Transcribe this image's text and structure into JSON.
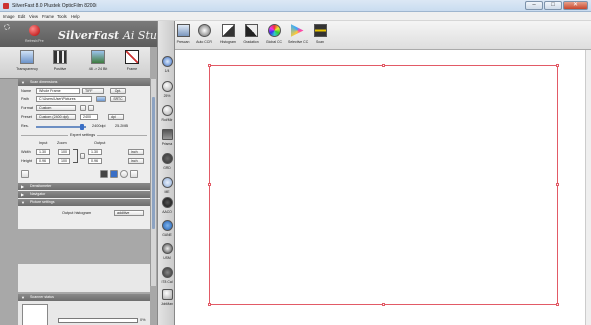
{
  "window": {
    "title": "SilverFast 8.0 Plustek OpticFilm 8200i",
    "buttons": [
      "–",
      "□",
      "✕"
    ]
  },
  "menu": [
    "Image",
    "Edit",
    "View",
    "Frame",
    "Tools",
    "Help"
  ],
  "app": {
    "brand": "SilverFast",
    "brand_suffix": "Ai Studio",
    "sub_label": "Refresh/Pre"
  },
  "modes": [
    {
      "label": "Transparency",
      "icon": "film-transparency-icon"
    },
    {
      "label": "Positive",
      "icon": "positive-icon"
    },
    {
      "label": "48 -> 24 Bit",
      "icon": "bit-depth-icon"
    },
    {
      "label": "Frame",
      "icon": "frame-icon",
      "active": true
    }
  ],
  "scan_dimensions": {
    "header": "Scan dimensions",
    "name_label": "Name",
    "name_value": "Whole Frame",
    "name_format": "TIFF",
    "name_btn": "Opt.",
    "path_label": "Path",
    "path_value": "C:\\Users\\User\\Pictures",
    "path_btn": "SRTC",
    "format_label": "Format",
    "format_value": "Custom",
    "preset_label": "Preset",
    "preset_value": "Custom (2400 dpi)",
    "preset_num": "2400",
    "preset_unit": "dpi",
    "res_label": "Res.",
    "res_dpi": "2400dpi",
    "res_mb": "25.2MB"
  },
  "expert": {
    "header": "Expert settings",
    "col_input": "Input",
    "col_zoom": "Zoom",
    "col_output": "Output",
    "width_label": "Width",
    "width_input": "1.30",
    "width_zoom": "100",
    "width_output": "1.30",
    "width_unit": "inch",
    "height_label": "Height",
    "height_input": "0.96",
    "height_zoom": "100",
    "height_output": "0.96",
    "height_unit": "inch"
  },
  "sections": {
    "densitometer": "Densitometer",
    "navigator": "Navigator",
    "picture_settings": "Picture settings",
    "scanner_status": "Scanner status"
  },
  "histogram": {
    "label": "Output histogram",
    "mode": "additive"
  },
  "scanner_status": {
    "progress": 0.0,
    "percent": "0%"
  },
  "tools": [
    {
      "label": "1/4",
      "icon": "info-icon"
    },
    {
      "label": "25%",
      "icon": "zoom-icon"
    },
    {
      "label": "Rot/Mir",
      "icon": "rotate-mirror-icon"
    },
    {
      "label": "Prisma",
      "icon": "prisma-icon"
    },
    {
      "label": "GRD",
      "icon": "grain-reduction-icon"
    },
    {
      "label": "ME",
      "icon": "multi-exposure-icon"
    },
    {
      "label": "AACO",
      "icon": "aaco-icon"
    },
    {
      "label": "GANE",
      "icon": "gane-icon"
    },
    {
      "label": "USM",
      "icon": "usm-icon"
    },
    {
      "label": "IT8 Cal",
      "icon": "it8-calibration-icon"
    },
    {
      "label": "JobMan",
      "icon": "job-manager-icon"
    }
  ],
  "toolbar": [
    {
      "label": "Prescan",
      "icon": "prescan-icon"
    },
    {
      "label": "Auto CCR",
      "icon": "auto-ccr-icon"
    },
    {
      "label": "Histogram",
      "icon": "histogram-icon"
    },
    {
      "label": "Gradation",
      "icon": "gradation-icon"
    },
    {
      "label": "Global CC",
      "icon": "global-cc-icon"
    },
    {
      "label": "Selective CC",
      "icon": "selective-cc-icon"
    },
    {
      "label": "Scan",
      "icon": "scan-icon"
    }
  ],
  "colors": {
    "frame": "#e25a66",
    "accent": "#3a6fc6"
  }
}
